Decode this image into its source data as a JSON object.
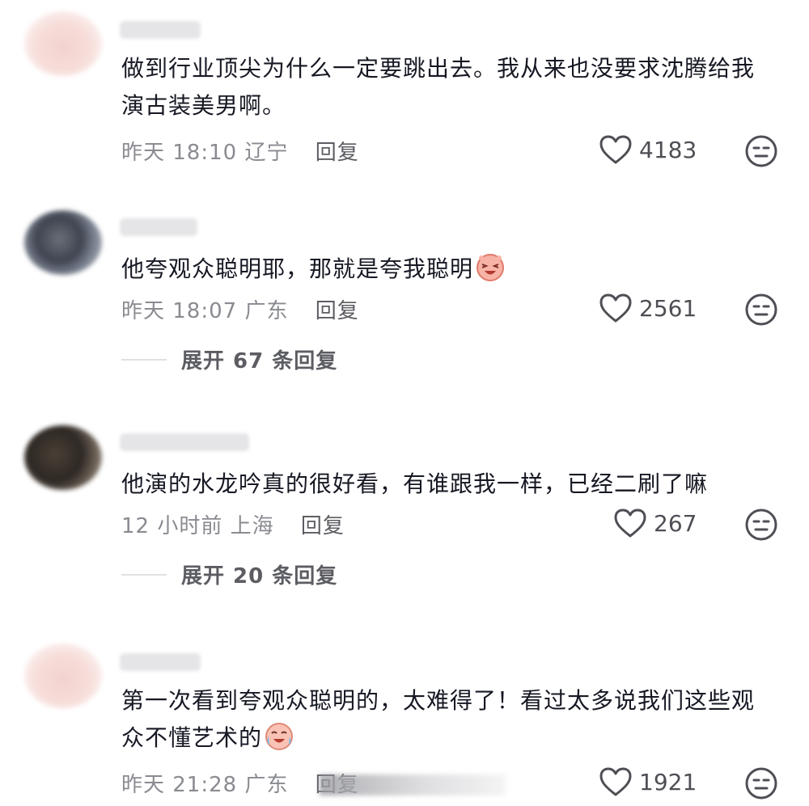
{
  "comments": [
    {
      "text": "做到行业顶尖为什么一定要跳出去。我从来也没要求沈腾给我演古装美男啊。",
      "time": "昨天 18:10",
      "location": "辽宁",
      "reply_label": "回复",
      "likes": "4183",
      "avatar": "pink-blurred-avatar"
    },
    {
      "text": "他夸观众聪明耶，那就是夸我聪明",
      "time": "昨天 18:07",
      "location": "广东",
      "reply_label": "回复",
      "likes": "2561",
      "emoji": "laughing-face-emoji",
      "expand_label": "展开 67 条回复",
      "avatar": "dark-blurred-avatar"
    },
    {
      "text": "他演的水龙吟真的很好看，有谁跟我一样，已经二刷了嘛",
      "time": "12 小时前",
      "location": "上海",
      "reply_label": "回复",
      "likes": "267",
      "expand_label": "展开 20 条回复",
      "avatar": "dark-blurred-avatar"
    },
    {
      "text": "第一次看到夸观众聪明的，太难得了！看过太多说我们这些观众不懂艺术的",
      "time": "昨天 21:28",
      "location": "广东",
      "reply_label": "回复",
      "likes": "1921",
      "emoji": "crying-laughing-emoji",
      "avatar": "pink-blurred-avatar"
    }
  ],
  "colors": {
    "text": "#161823",
    "meta": "#8a8b91",
    "icon": "#4e4f55"
  }
}
